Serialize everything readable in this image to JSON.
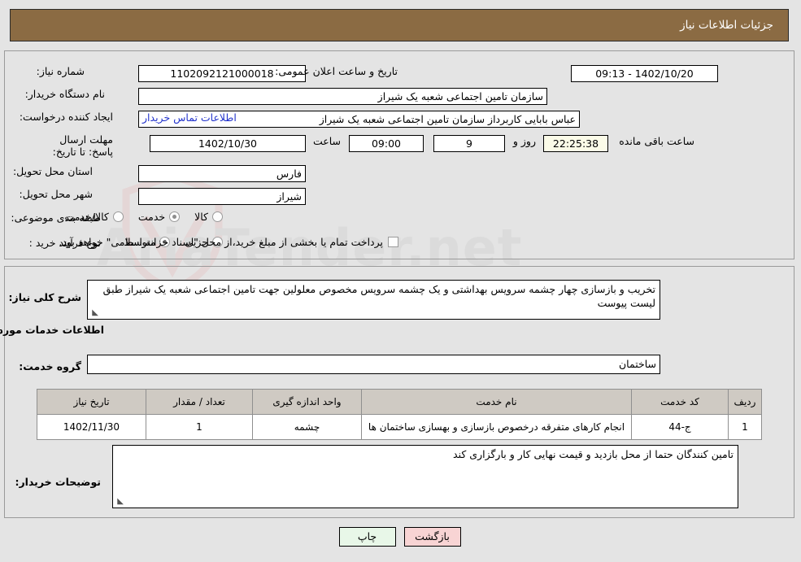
{
  "header": {
    "title": "جزئیات اطلاعات نیاز"
  },
  "form": {
    "need_number_label": "شماره نیاز:",
    "need_number_value": "1102092121000018",
    "public_announce_label": "تاریخ و ساعت اعلان عمومی:",
    "public_announce_value": "1402/10/20 - 09:13",
    "buyer_org_label": "نام دستگاه خریدار:",
    "buyer_org_value": "سازمان تامین اجتماعی شعبه یک شیراز",
    "creator_label": "ایجاد کننده درخواست:",
    "creator_value": "عباس بابایی  کاربرداز  سازمان تامین اجتماعی شعبه یک شیراز",
    "buyer_contact_link": "اطلاعات تماس خریدار",
    "deadline_label": "مهلت ارسال پاسخ: تا تاریخ:",
    "deadline_date": "1402/10/30",
    "hour_label": "ساعت",
    "deadline_time": "09:00",
    "remaining_days": "9",
    "days_and_label": "روز و",
    "remaining_time": "22:25:38",
    "remaining_suffix": "ساعت باقی مانده",
    "province_label": "استان محل تحویل:",
    "province_value": "فارس",
    "city_label": "شهر محل تحویل:",
    "city_value": "شیراز",
    "category_label": "طبقه بندی موضوعی:",
    "category_options": [
      {
        "label": "کالا",
        "selected": false
      },
      {
        "label": "خدمت",
        "selected": true
      },
      {
        "label": "کالا/خدمت",
        "selected": false
      }
    ],
    "process_label": "نوع فرآیند خرید :",
    "process_options": [
      {
        "label": "جزیی",
        "selected": false
      },
      {
        "label": "متوسط",
        "selected": true
      }
    ],
    "treasury_checkbox_label": "پرداخت تمام یا بخشی از مبلغ خرید،از محل \"اسناد خزانه اسلامی\" خواهد بود.",
    "treasury_checked": false
  },
  "summary": {
    "label": "شرح کلی نیاز:",
    "text": "تخریب و بازسازی چهار چشمه سرویس بهداشتی و یک چشمه سرویس مخصوص معلولین جهت تامین اجتماعی شعبه یک شیراز طبق لیست پیوست"
  },
  "services": {
    "section_title": "اطلاعات خدمات مورد نیاز",
    "group_label": "گروه خدمت:",
    "group_value": "ساختمان",
    "columns": [
      "ردیف",
      "کد خدمت",
      "نام خدمت",
      "واحد اندازه گیری",
      "تعداد / مقدار",
      "تاریخ نیاز"
    ],
    "rows": [
      {
        "row": "1",
        "code": "ج-44",
        "name": "انجام کارهای متفرقه درخصوص بازسازی و بهسازی ساختمان ها",
        "unit": "چشمه",
        "quantity": "1",
        "need_date": "1402/11/30"
      }
    ]
  },
  "buyer_notes": {
    "label": "توضیحات خریدار:",
    "text": "تامین کنندگان حتما از محل بازدید و قیمت نهایی کار و بارگزاری کند"
  },
  "buttons": {
    "print": "چاپ",
    "back": "بازگشت"
  },
  "watermark": {
    "text": "AriaTender.net"
  },
  "colors": {
    "header_brown": "#8b6b43",
    "page_bg": "#e4e4e4",
    "link_blue": "#2233cc",
    "table_header": "#cfcac3",
    "print_btn": "#e8f7e8",
    "back_btn": "#f8d4d4"
  }
}
